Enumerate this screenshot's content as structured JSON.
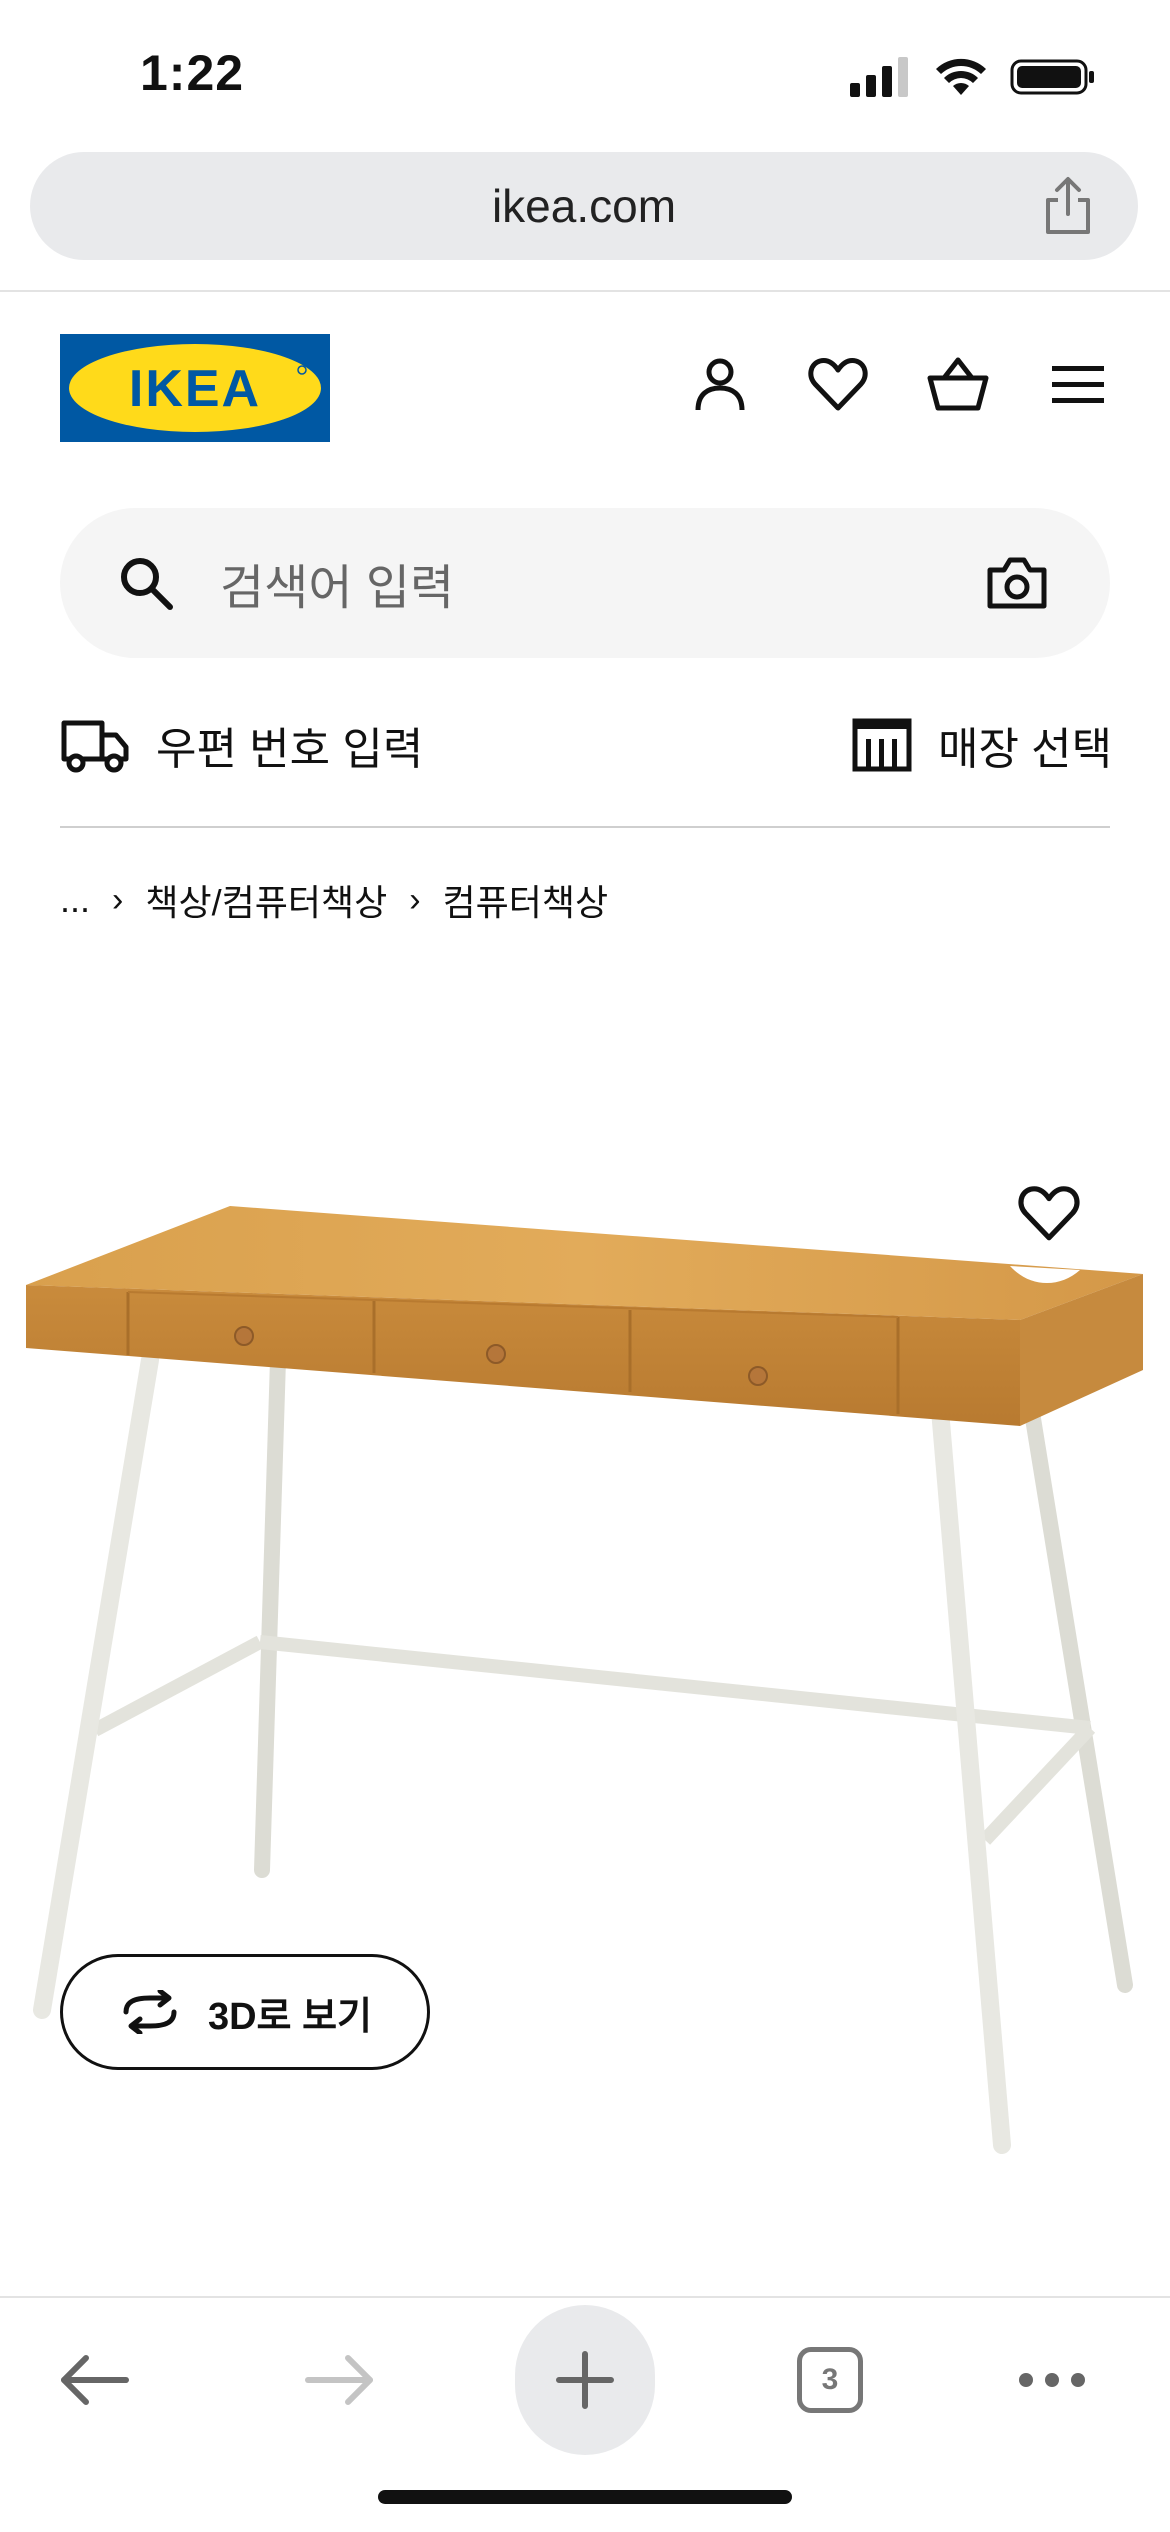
{
  "status_bar": {
    "time": "1:22"
  },
  "browser": {
    "url": "ikea.com",
    "tab_count": "3"
  },
  "header": {
    "logo_text": "IKEA",
    "icons": [
      "user-icon",
      "heart-icon",
      "cart-icon",
      "menu-icon"
    ]
  },
  "search": {
    "placeholder": "검색어 입력"
  },
  "location": {
    "postal_label": "우편 번호 입력",
    "store_label": "매장 선택"
  },
  "breadcrumb": {
    "items": [
      "...",
      "책상/컴퓨터책상",
      "컴퓨터책상"
    ]
  },
  "product": {
    "view_3d_label": "3D로 보기"
  },
  "colors": {
    "ikea_blue": "#0058a3",
    "ikea_yellow": "#ffda1a",
    "url_bar": "#e9eaec"
  }
}
